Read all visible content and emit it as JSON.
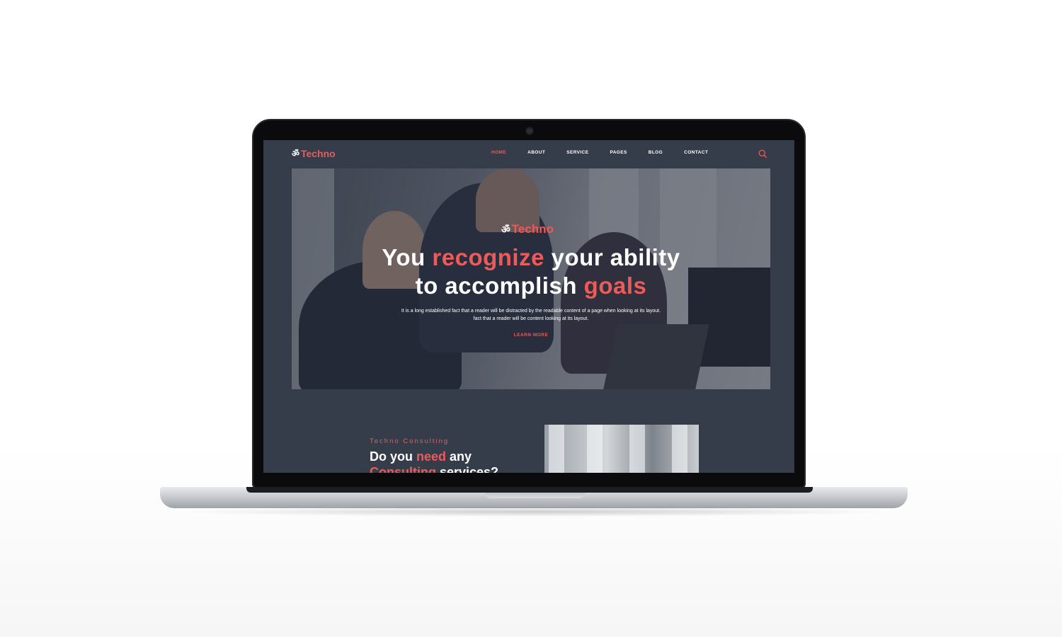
{
  "site": {
    "logo_text": "Techno",
    "nav": [
      {
        "label": "HOME",
        "active": true
      },
      {
        "label": "ABOUT",
        "active": false
      },
      {
        "label": "SERVICE",
        "active": false
      },
      {
        "label": "PAGES",
        "active": false
      },
      {
        "label": "BLOG",
        "active": false
      },
      {
        "label": "CONTACT",
        "active": false
      }
    ],
    "hero": {
      "logo_text": "Techno",
      "headline_1a": "You ",
      "headline_1b": "recognize",
      "headline_1c": " your ability",
      "headline_2a": "to accomplish ",
      "headline_2b": "goals",
      "description": "It is a long established fact that a reader will be distracted by the readable content of a page when looking at its layout. fact that a reader will be content looking at its layout.",
      "cta": "LEARN MORE"
    },
    "section": {
      "label": "Techno Consulting",
      "title_a": "Do you ",
      "title_b": "need",
      "title_c": " any",
      "title_d": "Consulting",
      "title_e": " services?"
    }
  },
  "colors": {
    "accent": "#ec5a5a",
    "background": "#353c4a"
  },
  "icons": {
    "search": "search-icon",
    "logo": "logo-icon"
  }
}
